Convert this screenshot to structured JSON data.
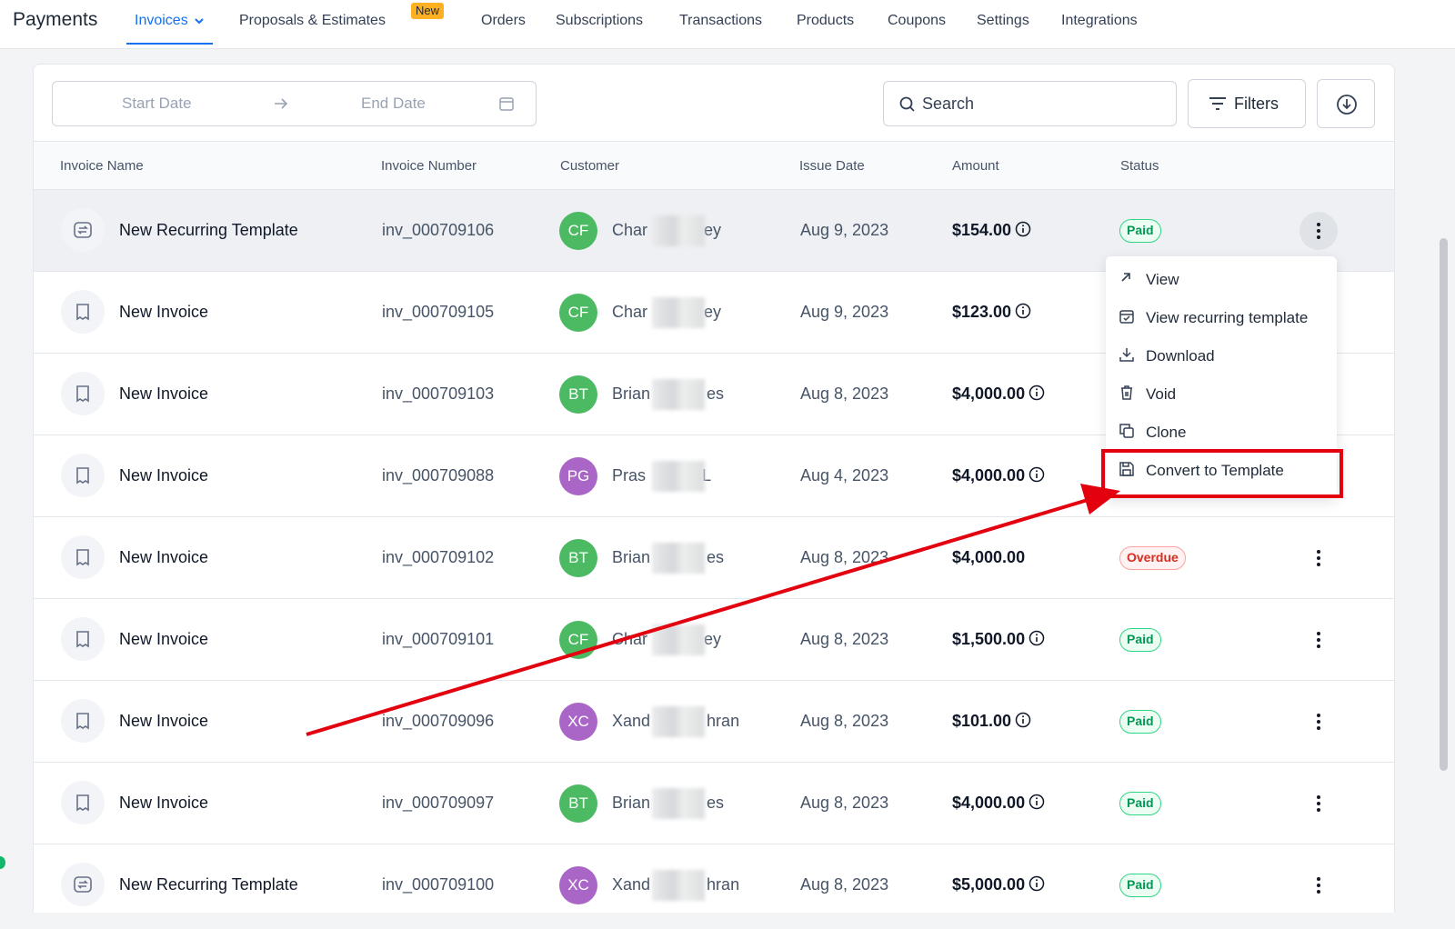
{
  "nav": {
    "brand": "Payments",
    "items": [
      "Invoices",
      "Proposals & Estimates",
      "Orders",
      "Subscriptions",
      "Transactions",
      "Products",
      "Coupons",
      "Settings",
      "Integrations"
    ],
    "new_badge": "New"
  },
  "toolbar": {
    "start_date_placeholder": "Start Date",
    "end_date_placeholder": "End Date",
    "search_placeholder": "Search",
    "filters_label": "Filters"
  },
  "table": {
    "columns": [
      "Invoice Name",
      "Invoice Number",
      "Customer",
      "Issue Date",
      "Amount",
      "Status"
    ],
    "rows": [
      {
        "icon": "recurring-icon",
        "name": "New Recurring Template",
        "number": "inv_000709106",
        "initials": "CF",
        "avatar_color": "#4cb963",
        "customer_start": "Char",
        "customer_end": "ey",
        "date": "Aug 9, 2023",
        "amount": "$154.00",
        "info": true,
        "status": "Paid"
      },
      {
        "icon": "invoice-icon",
        "name": "New Invoice",
        "number": "inv_000709105",
        "initials": "CF",
        "avatar_color": "#4cb963",
        "customer_start": "Char",
        "customer_end": "ey",
        "date": "Aug 9, 2023",
        "amount": "$123.00",
        "info": true,
        "status": ""
      },
      {
        "icon": "invoice-icon",
        "name": "New Invoice",
        "number": "inv_000709103",
        "initials": "BT",
        "avatar_color": "#4cb963",
        "customer_start": "Brian",
        "customer_end": "es",
        "date": "Aug 8, 2023",
        "amount": "$4,000.00",
        "info": true,
        "status": ""
      },
      {
        "icon": "invoice-icon",
        "name": "New Invoice",
        "number": "inv_000709088",
        "initials": "PG",
        "avatar_color": "#a966c7",
        "customer_start": "Pras",
        "customer_end": "L",
        "date": "Aug 4, 2023",
        "amount": "$4,000.00",
        "info": true,
        "status": ""
      },
      {
        "icon": "invoice-icon",
        "name": "New Invoice",
        "number": "inv_000709102",
        "initials": "BT",
        "avatar_color": "#4cb963",
        "customer_start": "Brian",
        "customer_end": "es",
        "date": "Aug 8, 2023",
        "amount": "$4,000.00",
        "info": false,
        "status": "Overdue"
      },
      {
        "icon": "invoice-icon",
        "name": "New Invoice",
        "number": "inv_000709101",
        "initials": "CF",
        "avatar_color": "#4cb963",
        "customer_start": "Char",
        "customer_end": "ey",
        "date": "Aug 8, 2023",
        "amount": "$1,500.00",
        "info": true,
        "status": "Paid"
      },
      {
        "icon": "invoice-icon",
        "name": "New Invoice",
        "number": "inv_000709096",
        "initials": "XC",
        "avatar_color": "#a966c7",
        "customer_start": "Xand",
        "customer_end": "hran",
        "date": "Aug 8, 2023",
        "amount": "$101.00",
        "info": true,
        "status": "Paid"
      },
      {
        "icon": "invoice-icon",
        "name": "New Invoice",
        "number": "inv_000709097",
        "initials": "BT",
        "avatar_color": "#4cb963",
        "customer_start": "Brian",
        "customer_end": "es",
        "date": "Aug 8, 2023",
        "amount": "$4,000.00",
        "info": true,
        "status": "Paid"
      },
      {
        "icon": "recurring-icon",
        "name": "New Recurring Template",
        "number": "inv_000709100",
        "initials": "XC",
        "avatar_color": "#a966c7",
        "customer_start": "Xand",
        "customer_end": "hran",
        "date": "Aug 8, 2023",
        "amount": "$5,000.00",
        "info": true,
        "status": "Paid"
      }
    ]
  },
  "menu": {
    "items": [
      {
        "label": "View",
        "icon": "arrow-up-right-icon"
      },
      {
        "label": "View recurring template",
        "icon": "calendar-check-icon"
      },
      {
        "label": "Download",
        "icon": "download-icon"
      },
      {
        "label": "Void",
        "icon": "trash-icon"
      },
      {
        "label": "Clone",
        "icon": "copy-icon"
      },
      {
        "label": "Convert to Template",
        "icon": "save-icon"
      }
    ]
  },
  "colors": {
    "accent": "#1570ef",
    "annotation": "#e3000f",
    "paid": "#039855",
    "overdue": "#d92d20"
  }
}
